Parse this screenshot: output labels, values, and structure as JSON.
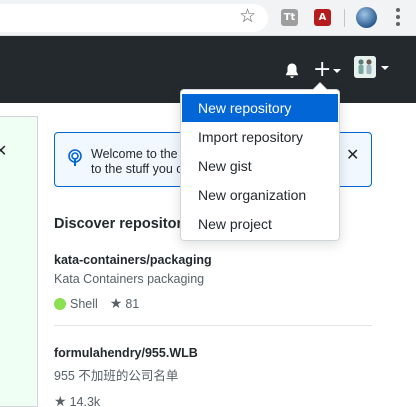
{
  "browser": {
    "extensions": [
      {
        "name": "ext-icon-1",
        "glyph": "Tt"
      },
      {
        "name": "pdf-icon",
        "glyph": "A"
      },
      {
        "name": "globe-avatar-icon",
        "glyph": ""
      }
    ]
  },
  "header": {
    "icons": [
      "bell-icon",
      "plus-icon",
      "avatar"
    ]
  },
  "new_menu": {
    "items": [
      {
        "label": "New repository",
        "active": true
      },
      {
        "label": "Import repository",
        "active": false
      },
      {
        "label": "New gist",
        "active": false
      },
      {
        "label": "New organization",
        "active": false
      },
      {
        "label": "New project",
        "active": false
      }
    ]
  },
  "banner": {
    "line1": "Welcome to the",
    "line2": "to the stuff you c"
  },
  "discover": {
    "title": "Discover repositories"
  },
  "repos": [
    {
      "name": "kata-containers/packaging",
      "description": "Kata Containers packaging",
      "language": "Shell",
      "language_color": "#89e051",
      "stars": "81"
    },
    {
      "name": "formulahendry/955.WLB",
      "description": "955 不加班的公司名单",
      "language": "",
      "language_color": "",
      "stars": "14.3k"
    }
  ],
  "colors": {
    "header_bg": "#24292e",
    "accent": "#0366d6",
    "shell": "#89e051"
  }
}
